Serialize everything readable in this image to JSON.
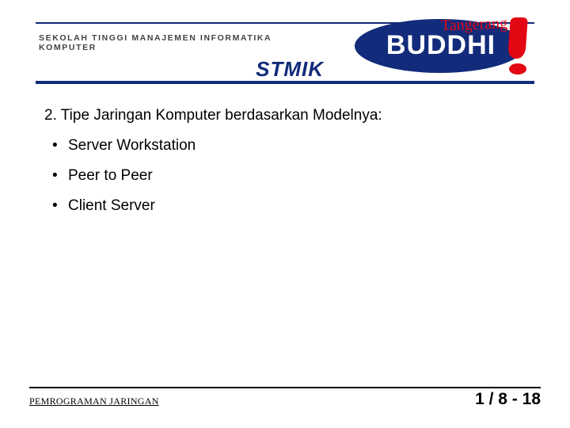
{
  "header": {
    "institution_line": "SEKOLAH TINGGI MANAJEMEN INFORMATIKA KOMPUTER",
    "acronym": "STMIK",
    "logo": {
      "city": "Tangerang",
      "brand": "BUDDHI"
    }
  },
  "content": {
    "heading": "2. Tipe Jaringan Komputer berdasarkan Modelnya:",
    "bullets": [
      "Server Workstation",
      "Peer to Peer",
      "Client Server"
    ]
  },
  "footer": {
    "course": "PEMROGRAMAN JARINGAN",
    "page": "1 / 8 - 18"
  }
}
